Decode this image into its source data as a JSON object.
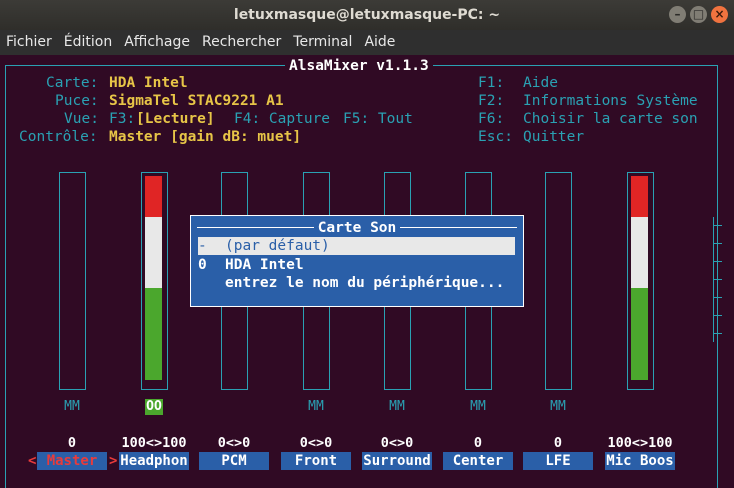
{
  "window": {
    "title": "letuxmasque@letuxmasque-PC: ~",
    "btn_min": "–",
    "btn_max": "□",
    "btn_close": "×"
  },
  "menu": [
    "Fichier",
    "Édition",
    "Affichage",
    "Rechercher",
    "Terminal",
    "Aide"
  ],
  "alsamixer": {
    "title": "AlsaMixer v1.1.3",
    "info": {
      "card_label": "Carte:",
      "card_value": "HDA Intel",
      "chip_label": "Puce:",
      "chip_value": "SigmaTel STAC9221 A1",
      "view_label": "Vue:",
      "view_f3": "F3:",
      "view_play": "[Lecture]",
      "view_f4": "F4: Capture",
      "view_f5": "F5: Tout",
      "control_label": "Contrôle:",
      "control_value": "Master [gain dB: muet]"
    },
    "keys": [
      {
        "key": "F1:",
        "desc": "Aide"
      },
      {
        "key": "F2:",
        "desc": "Informations Système"
      },
      {
        "key": "F6:",
        "desc": "Choisir la carte son"
      },
      {
        "key": "Esc:",
        "desc": "Quitter"
      }
    ],
    "channels": [
      {
        "name": "Master",
        "value": "0",
        "mute": "MM",
        "level": 0
      },
      {
        "name": "Headphon",
        "value": "100<>100",
        "mute": "OO",
        "level": 1.0
      },
      {
        "name": "PCM",
        "value": "0<>0",
        "mute": "",
        "level": 0
      },
      {
        "name": "Front",
        "value": "0<>0",
        "mute": "MM",
        "level": 0
      },
      {
        "name": "Surround",
        "value": "0<>0",
        "mute": "MM",
        "level": 0
      },
      {
        "name": "Center",
        "value": "0",
        "mute": "MM",
        "level": 0
      },
      {
        "name": "LFE",
        "value": "0",
        "mute": "MM",
        "level": 0
      },
      {
        "name": "Mic Boos",
        "value": "100<>100",
        "mute": "",
        "level": 1.0
      }
    ],
    "selected_marker_left": "<",
    "selected_marker_right": ">",
    "dialog": {
      "title": "Carte Son",
      "options": [
        {
          "prefix": "-",
          "label": "(par défaut)"
        },
        {
          "prefix": "0",
          "label": "HDA Intel"
        },
        {
          "prefix": "",
          "label": "entrez le nom du périphérique..."
        }
      ]
    }
  },
  "colors": {
    "bg": "#300a24",
    "cyan": "#2aa1b3",
    "yellow": "#e7c547",
    "blue": "#2a5fa8",
    "green": "#4ba72d",
    "red": "#e02525"
  }
}
